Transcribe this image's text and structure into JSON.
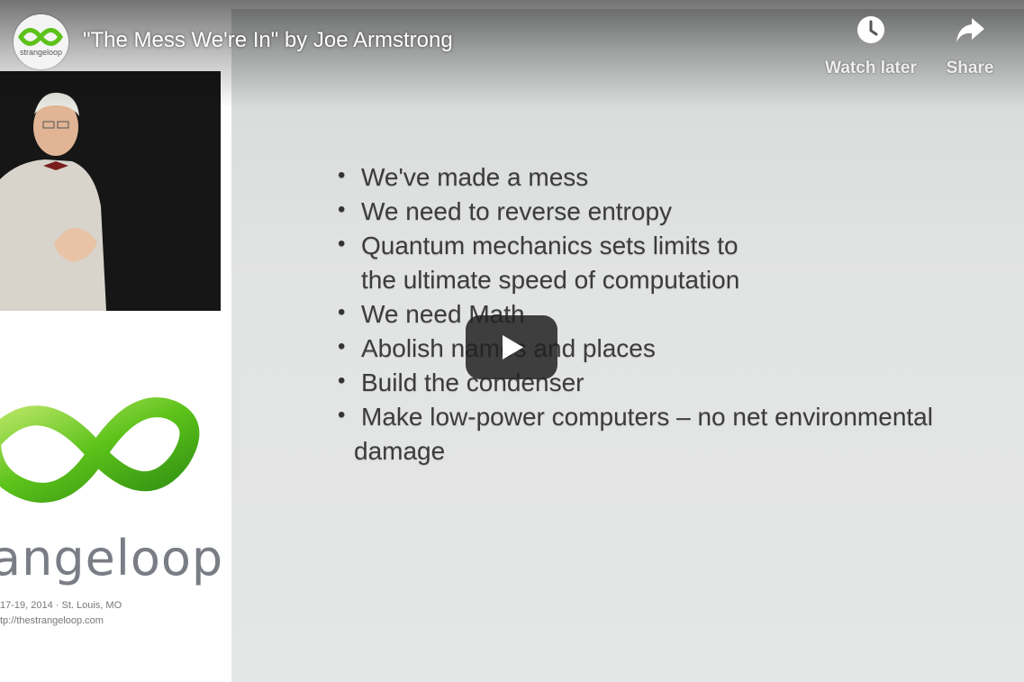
{
  "video": {
    "title": "\"The Mess We're In\" by Joe Armstrong",
    "channel_avatar_text": "strangeloop"
  },
  "actions": {
    "watch_later_label": "Watch later",
    "share_label": "Share",
    "watch_later_icon": "clock-icon",
    "share_icon": "share-arrow-icon",
    "play_icon": "play-icon"
  },
  "slide": {
    "bullets": [
      "We've made a mess",
      "We need to reverse entropy",
      "Quantum mechanics sets limits to",
      "the ultimate speed of computation",
      "We need Math",
      "Abolish names and places",
      "Build the condenser",
      "Make low-power computers – no net environmental",
      "damage"
    ]
  },
  "conference": {
    "wordmark": "angeloop",
    "date_location": "17-19, 2014  ·  St. Louis, MO",
    "url": "tp://thestrangeloop.com"
  },
  "colors": {
    "logo_green": "#5cc21a",
    "play_bg": "#212121",
    "slide_bg": "#e3e4e4"
  }
}
